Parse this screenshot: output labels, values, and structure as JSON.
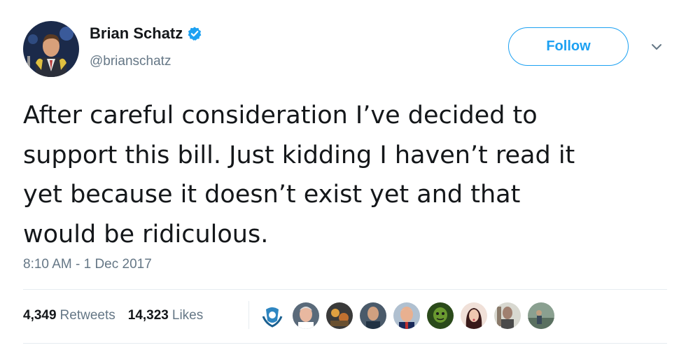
{
  "author": {
    "name": "Brian Schatz",
    "handle": "@brianschatz",
    "verified": true,
    "avatar_icon": "avatar-photo"
  },
  "header": {
    "follow_label": "Follow",
    "menu_icon": "chevron-down-icon"
  },
  "tweet": {
    "line1": "After careful consideration I’ve decided to",
    "line2": "support this bill. Just kidding I haven’t read it",
    "line3": "yet because it doesn’t exist yet and that",
    "line4": "would be ridiculous.",
    "timestamp": "8:10 AM - 1 Dec 2017"
  },
  "stats": {
    "retweets_count": "4,349",
    "retweets_label": "Retweets",
    "likes_count": "14,323",
    "likes_label": "Likes"
  },
  "colors": {
    "accent": "#1da1f2",
    "text": "#14171a",
    "secondary": "#657786",
    "divider": "#e6ecf0"
  },
  "likers": [
    {
      "icon": "liker-avatar-1"
    },
    {
      "icon": "liker-avatar-2"
    },
    {
      "icon": "liker-avatar-3"
    },
    {
      "icon": "liker-avatar-4"
    },
    {
      "icon": "liker-avatar-5"
    },
    {
      "icon": "liker-avatar-6"
    },
    {
      "icon": "liker-avatar-7"
    },
    {
      "icon": "liker-avatar-8"
    },
    {
      "icon": "liker-avatar-9"
    }
  ]
}
